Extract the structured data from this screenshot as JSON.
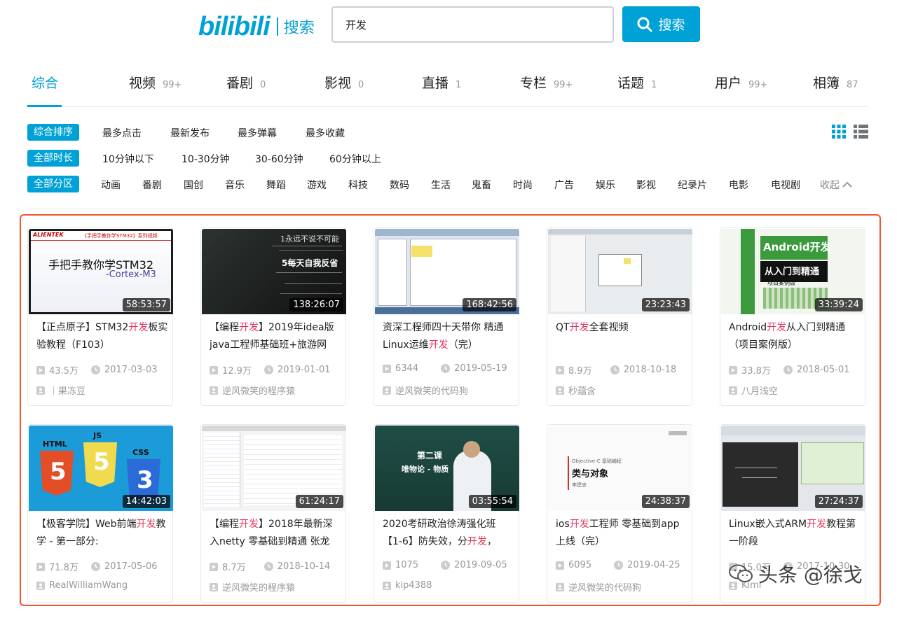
{
  "header": {
    "logo_text": "bilibili",
    "logo_sub": "搜索",
    "search_value": "开发",
    "search_button": "搜索"
  },
  "tabs": [
    {
      "label": "综合",
      "count": ""
    },
    {
      "label": "视频",
      "count": "99+"
    },
    {
      "label": "番剧",
      "count": "0"
    },
    {
      "label": "影视",
      "count": "0"
    },
    {
      "label": "直播",
      "count": "1"
    },
    {
      "label": "专栏",
      "count": "99+"
    },
    {
      "label": "话题",
      "count": "1"
    },
    {
      "label": "用户",
      "count": "99+"
    },
    {
      "label": "相簿",
      "count": "87"
    }
  ],
  "filters": {
    "order": {
      "active": "综合排序",
      "options": [
        "最多点击",
        "最新发布",
        "最多弹幕",
        "最多收藏"
      ]
    },
    "duration": {
      "active": "全部时长",
      "options": [
        "10分钟以下",
        "10-30分钟",
        "30-60分钟",
        "60分钟以上"
      ]
    },
    "zone": {
      "active": "全部分区",
      "options": [
        "动画",
        "番剧",
        "国创",
        "音乐",
        "舞蹈",
        "游戏",
        "科技",
        "数码",
        "生活",
        "鬼畜",
        "时尚",
        "广告",
        "娱乐",
        "影视",
        "纪录片",
        "电影",
        "电视剧"
      ],
      "collapse": "收起"
    }
  },
  "videos": [
    {
      "t1": "【正点原子】STM32",
      "hl": "开发",
      "t2": "板实验教程（F103）",
      "duration": "58:53:57",
      "views": "43.5万",
      "date": "2017-03-03",
      "uploader": "｜果冻豆",
      "thumb_text": [
        "ALIENTEK",
        "《手把手教你学STM32》系列视频",
        "手把手教你学STM32",
        "-Cortex-M3"
      ]
    },
    {
      "t1": "【编程",
      "hl": "开发",
      "t2": "】2019年idea版java工程师基础班+旅游网",
      "duration": "138:26:07",
      "views": "12.9万",
      "date": "2019-01-01",
      "uploader": "逆风微笑的程序猿",
      "thumb_text": [
        "1永远不说不可能",
        "5每天自我反省"
      ]
    },
    {
      "t1": "资深工程师四十天带你 精通Linux运维",
      "hl": "开发",
      "t2": "（完）",
      "duration": "168:42:56",
      "views": "6344",
      "date": "2019-05-19",
      "uploader": "逆风微笑的代码狗",
      "thumb_text": []
    },
    {
      "t1": "QT",
      "hl": "开发",
      "t2": "全套视频",
      "duration": "23:23:43",
      "views": "8.9万",
      "date": "2018-10-18",
      "uploader": "秒蕴含",
      "thumb_text": []
    },
    {
      "t1": "Android",
      "hl": "开发",
      "t2": "从入门到精通（项目案例版）",
      "duration": "33:39:24",
      "views": "33.8万",
      "date": "2018-05-01",
      "uploader": "八月浅空",
      "thumb_text": [
        "Android开发",
        "从入门到精通",
        "项目案例版"
      ]
    },
    {
      "t1": "【极客学院】Web前端",
      "hl": "开发",
      "t2": "教学 - 第一部分:",
      "duration": "14:42:03",
      "views": "71.8万",
      "date": "2017-05-06",
      "uploader": "RealWilliamWang",
      "thumb_text": [
        "HTML",
        "JS",
        "CSS",
        "5",
        "5",
        "3"
      ]
    },
    {
      "t1": "【编程",
      "hl": "开发",
      "t2": "】2018年最新深入netty 零基础到精通 张龙",
      "duration": "61:24:17",
      "views": "8.7万",
      "date": "2018-10-14",
      "uploader": "逆风微笑的程序猿",
      "thumb_text": []
    },
    {
      "t1": "2020考研政治徐涛强化班【1-6】防失效，分",
      "hl": "开发",
      "t2": "，",
      "duration": "03:55:54",
      "views": "1075",
      "date": "2019-09-05",
      "uploader": "kip4388",
      "thumb_text": [
        "第二课",
        "唯物论 - 物质"
      ]
    },
    {
      "t1": "ios",
      "hl": "开发",
      "t2": "工程师 零基础到app上线（完）",
      "duration": "24:38:37",
      "views": "6095",
      "date": "2019-04-25",
      "uploader": "逆风微笑的代码狗",
      "thumb_text": [
        "Objective-C 基础编程",
        "类与对象",
        "李建忠"
      ]
    },
    {
      "t1": "Linux嵌入式ARM",
      "hl": "开发",
      "t2": "教程第一阶段",
      "duration": "27:24:37",
      "views": "15.0万",
      "date": "2017-10-30",
      "uploader": "Kimi",
      "thumb_text": []
    }
  ],
  "watermark": "头条 @徐戈",
  "colors": {
    "accent": "#00a1d6",
    "highlight": "#e4365d",
    "frame": "#f2552c"
  }
}
